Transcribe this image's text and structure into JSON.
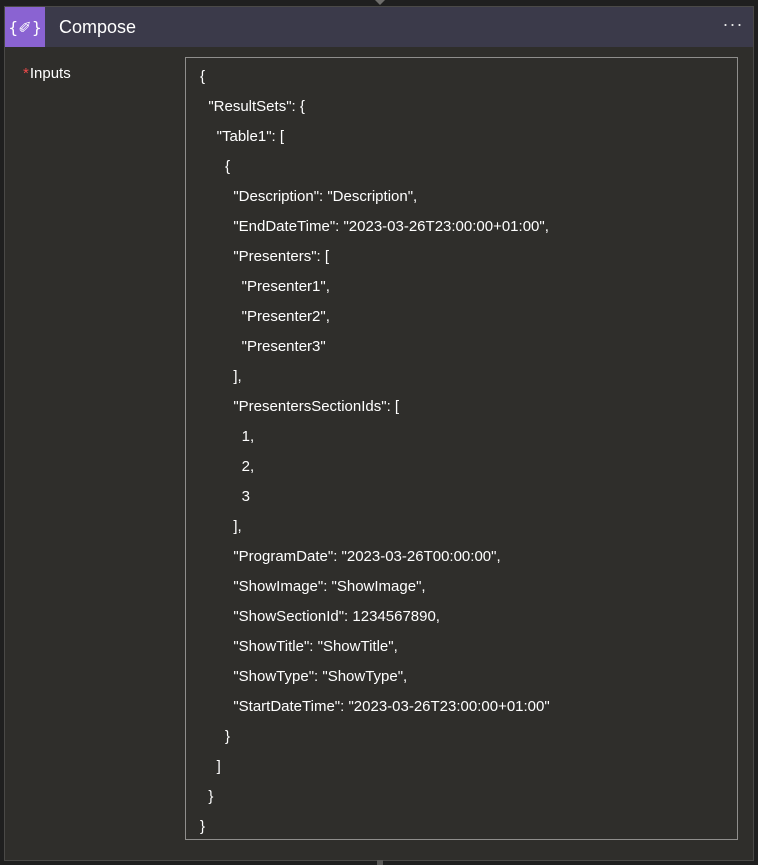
{
  "action": {
    "title": "Compose",
    "icon": "compose-curly-braces-icon",
    "icon_glyph": "{✐}",
    "more_label": "···",
    "accent_color": "#8a63d2"
  },
  "inputs": {
    "required_marker": "*",
    "label": "Inputs",
    "lines": [
      "{",
      "  \"ResultSets\": {",
      "    \"Table1\": [",
      "      {",
      "        \"Description\": \"Description\",",
      "        \"EndDateTime\": \"2023-03-26T23:00:00+01:00\",",
      "        \"Presenters\": [",
      "          \"Presenter1\",",
      "          \"Presenter2\",",
      "          \"Presenter3\"",
      "        ],",
      "        \"PresentersSectionIds\": [",
      "          1,",
      "          2,",
      "          3",
      "        ],",
      "        \"ProgramDate\": \"2023-03-26T00:00:00\",",
      "        \"ShowImage\": \"ShowImage\",",
      "        \"ShowSectionId\": 1234567890,",
      "        \"ShowTitle\": \"ShowTitle\",",
      "        \"ShowType\": \"ShowType\",",
      "        \"StartDateTime\": \"2023-03-26T23:00:00+01:00\"",
      "      }",
      "    ]",
      "  }",
      "}"
    ]
  }
}
